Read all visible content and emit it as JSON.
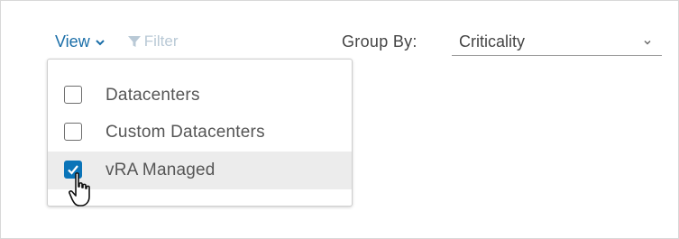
{
  "toolbar": {
    "view_label": "View",
    "view_icon": "chevron-down-icon",
    "filter_label": "Filter",
    "filter_icon": "funnel-icon"
  },
  "group_by": {
    "label": "Group By:",
    "selected": "Criticality",
    "icon": "chevron-down-icon"
  },
  "view_menu": {
    "items": [
      {
        "label": "Datacenters",
        "checked": false
      },
      {
        "label": "Custom Datacenters",
        "checked": false
      },
      {
        "label": "vRA Managed",
        "checked": true
      }
    ]
  },
  "colors": {
    "accent": "#1a6ea8",
    "checkbox_checked": "#0a74b8",
    "disabled": "#b9c9d6",
    "hover_row": "#ececec"
  }
}
